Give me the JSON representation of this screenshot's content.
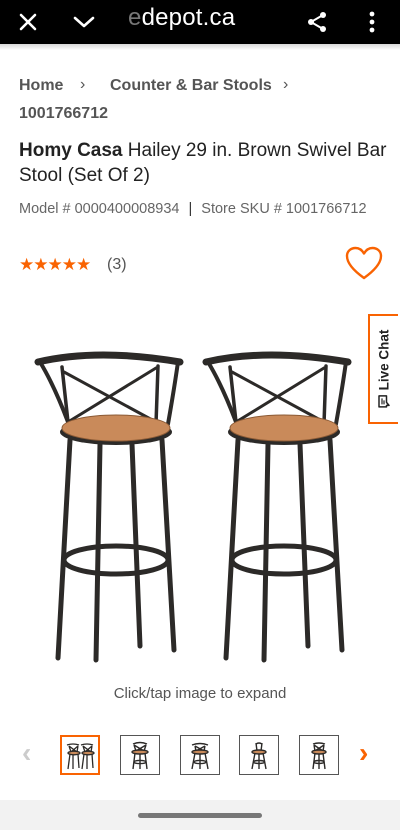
{
  "browser": {
    "url_faded": "e",
    "url_main": "depot.ca",
    "icons": [
      "close-icon",
      "chevron-down-icon",
      "share-icon",
      "more-vert-icon"
    ]
  },
  "breadcrumb": {
    "items": [
      "Home",
      "Counter & Bar Stools",
      "1001766712"
    ]
  },
  "product": {
    "brand": "Homy Casa",
    "name": "Hailey 29 in. Brown Swivel Bar Stool (Set Of 2)",
    "model_line": "Model # 0000400008934",
    "separator": "|",
    "sku_line": "Store SKU # 1001766712",
    "rating_stars": "★★★★★",
    "rating": 4.5,
    "review_count": "(3)"
  },
  "gallery": {
    "expand_hint": "Click/tap image to expand",
    "selected_index": 0,
    "thumb_count": 5
  },
  "live_chat": {
    "label": "Live Chat"
  },
  "colors": {
    "accent": "#f96302",
    "seat": "#c98a5a",
    "frame": "#2c2a28"
  }
}
